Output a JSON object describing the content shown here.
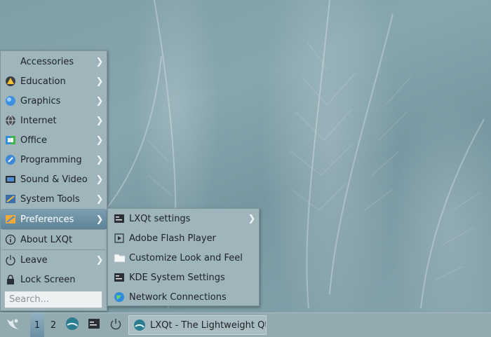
{
  "menu": {
    "items": [
      {
        "label": "Accessories",
        "icon": "accessories-icon"
      },
      {
        "label": "Education",
        "icon": "education-icon"
      },
      {
        "label": "Graphics",
        "icon": "graphics-icon"
      },
      {
        "label": "Internet",
        "icon": "internet-icon"
      },
      {
        "label": "Office",
        "icon": "office-icon"
      },
      {
        "label": "Programming",
        "icon": "programming-icon"
      },
      {
        "label": "Sound & Video",
        "icon": "sound-video-icon"
      },
      {
        "label": "System Tools",
        "icon": "system-tools-icon"
      },
      {
        "label": "Preferences",
        "icon": "preferences-icon"
      },
      {
        "label": "About LXQt",
        "icon": "info-icon"
      },
      {
        "label": "Leave",
        "icon": "power-icon"
      },
      {
        "label": "Lock Screen",
        "icon": "lock-icon"
      }
    ],
    "search_placeholder": "Search..."
  },
  "submenu": {
    "items": [
      {
        "label": "LXQt settings",
        "icon": "lxqt-settings-icon"
      },
      {
        "label": "Adobe Flash Player",
        "icon": "flash-player-icon"
      },
      {
        "label": "Customize Look and Feel",
        "icon": "folder-icon"
      },
      {
        "label": "KDE System Settings",
        "icon": "kde-settings-icon"
      },
      {
        "label": "Network Connections",
        "icon": "globe-icon"
      }
    ]
  },
  "taskbar": {
    "desktops": [
      "1",
      "2"
    ],
    "active_desktop": "1",
    "task_title": "LXQt - The Lightweight Qt D"
  },
  "colors": {
    "menu_bg": "#9fb4bb",
    "selected": "#6a8fa2",
    "taskbar_bg": "#94aab1"
  }
}
